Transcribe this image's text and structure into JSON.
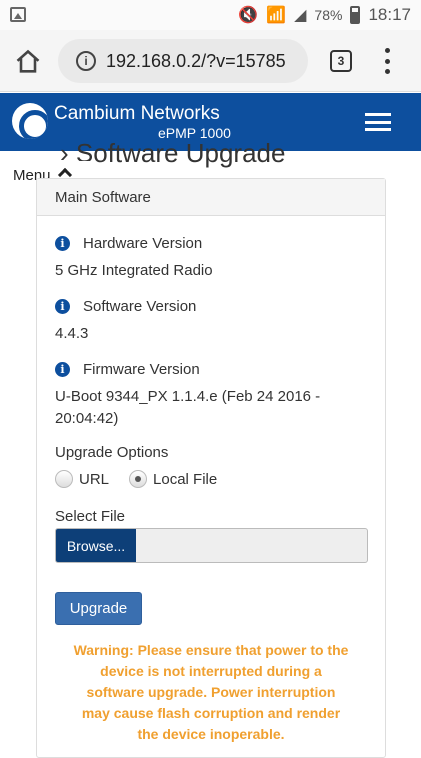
{
  "status_bar": {
    "battery": "78%",
    "time": "18:17"
  },
  "browser": {
    "url": "192.168.0.2/?v=15785",
    "tab_count": "3"
  },
  "header": {
    "brand": "Cambium Networks",
    "product": "ePMP 1000"
  },
  "page": {
    "title": "Software Upgrade",
    "menu_label": "Menu"
  },
  "panel": {
    "title": "Main Software",
    "hardware_label": "Hardware Version",
    "hardware_value": "5 GHz Integrated Radio",
    "software_label": "Software Version",
    "software_value": "4.4.3",
    "firmware_label": "Firmware Version",
    "firmware_value": "U-Boot 9344_PX 1.1.4.e (Feb 24 2016 - 20:04:42)",
    "upgrade_options_label": "Upgrade Options",
    "option_url": "URL",
    "option_local": "Local File",
    "select_file_label": "Select File",
    "browse_label": "Browse...",
    "upgrade_button": "Upgrade",
    "warning": "Warning: Please ensure that power to the device is not interrupted during a software upgrade. Power interruption may cause flash corruption and render the device inoperable."
  },
  "colors": {
    "brand_blue": "#0d4f9e",
    "warning": "#f0a030"
  }
}
